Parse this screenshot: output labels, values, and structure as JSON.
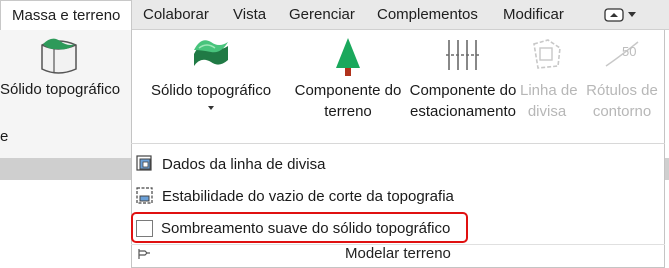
{
  "tabs": [
    {
      "label": "Massa e terreno",
      "active": true
    },
    {
      "label": "Colaborar"
    },
    {
      "label": "Vista"
    },
    {
      "label": "Gerenciar"
    },
    {
      "label": "Complementos"
    },
    {
      "label": "Modificar"
    }
  ],
  "left_panel": {
    "button_label": "Sólido topográfico",
    "panel_title_fragment": "e"
  },
  "ribbon": {
    "buttons": [
      {
        "label": "Sólido topográfico",
        "icon": "toposolid-icon"
      },
      {
        "label": "Componente do terreno",
        "line1": "Componente do",
        "line2": "terreno",
        "icon": "tree-icon"
      },
      {
        "label": "Componente do estacionamento",
        "line1": "Componente do",
        "line2": "estacionamento",
        "icon": "parking-icon"
      },
      {
        "label": "Linha de divisa",
        "line1": "Linha de",
        "line2": "divisa",
        "icon": "property-line-icon",
        "disabled": true
      },
      {
        "label": "Rótulos de contorno",
        "line1": "Rótulos de",
        "line2": "contorno",
        "icon": "contour-label-icon",
        "contour_value": "50",
        "disabled": true
      }
    ]
  },
  "menu": {
    "items": [
      {
        "label": "Dados da linha de divisa",
        "icon": "property-data-icon"
      },
      {
        "label": "Estabilidade do vazio de corte da topografia",
        "icon": "cut-void-icon"
      },
      {
        "label": "Sombreamento suave do sólido topográfico",
        "icon": "checkbox",
        "checked": false,
        "highlighted": true
      }
    ],
    "footer_label": "Modelar terreno"
  },
  "colors": {
    "highlight": "#e01010",
    "toposolid_green": "#2e9a5a",
    "tree_green": "#1aa85c",
    "trunk": "#b0321c",
    "disabled": "#b7b7b7"
  }
}
